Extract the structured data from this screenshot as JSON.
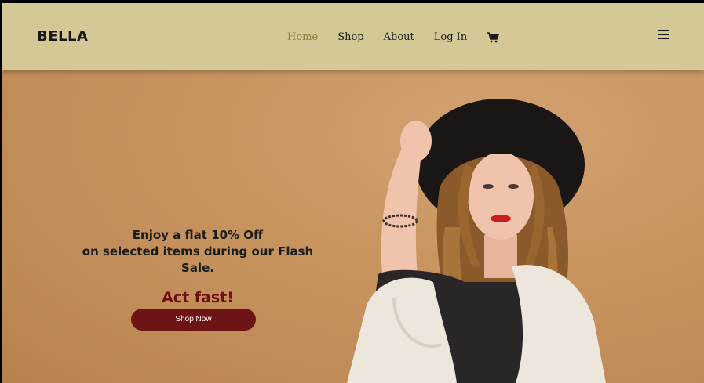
{
  "brand": {
    "logo": "BELLA"
  },
  "nav": {
    "items": [
      {
        "label": "Home",
        "active": true
      },
      {
        "label": "Shop",
        "active": false
      },
      {
        "label": "About",
        "active": false
      },
      {
        "label": "Log In",
        "active": false
      }
    ],
    "cart_icon": "shopping-cart-icon",
    "menu_icon": "hamburger-menu-icon"
  },
  "hero": {
    "offer_line1": "Enjoy a flat 10% Off",
    "offer_line2": "on selected items during our Flash Sale.",
    "cta_text": "Act fast!",
    "button_label": "Shop Now"
  },
  "colors": {
    "navbar_bg": "#d4c996",
    "hero_bg": "#c8955f",
    "accent": "#6d1414",
    "active_nav": "#8a7a3e"
  }
}
